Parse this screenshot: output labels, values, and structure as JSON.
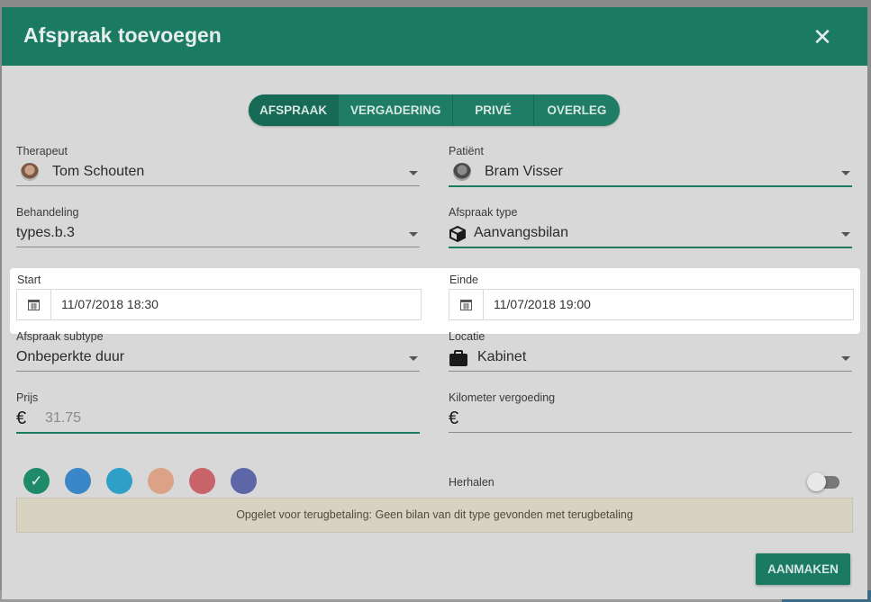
{
  "dialog": {
    "title": "Afspraak toevoegen",
    "close_icon": "close-icon"
  },
  "tabs": [
    {
      "label": "AFSPRAAK",
      "active": true
    },
    {
      "label": "VERGADERING",
      "active": false
    },
    {
      "label": "PRIVÉ",
      "active": false
    },
    {
      "label": "OVERLEG",
      "active": false
    }
  ],
  "fields": {
    "therapeut": {
      "label": "Therapeut",
      "value": "Tom Schouten"
    },
    "patient": {
      "label": "Patiënt",
      "value": "Bram Visser"
    },
    "behandeling": {
      "label": "Behandeling",
      "value": "types.b.3"
    },
    "afspraak_type": {
      "label": "Afspraak type",
      "value": "Aanvangsbilan",
      "icon": "cube-icon"
    },
    "start": {
      "label": "Start",
      "value": "11/07/2018 18:30",
      "icon": "calendar-icon"
    },
    "einde": {
      "label": "Einde",
      "value": "11/07/2018 19:00",
      "icon": "calendar-icon"
    },
    "subtype": {
      "label": "Afspraak subtype",
      "value": "Onbeperkte duur"
    },
    "locatie": {
      "label": "Locatie",
      "value": "Kabinet",
      "icon": "briefcase-icon"
    },
    "prijs": {
      "label": "Prijs",
      "value": "31.75",
      "symbol": "€"
    },
    "kilometer": {
      "label": "Kilometer vergoeding",
      "value": "",
      "symbol": "€"
    }
  },
  "colors": [
    "#1f8a6a",
    "#3a86c8",
    "#2ea0c8",
    "#dba288",
    "#c9636a",
    "#5d67a8"
  ],
  "selected_color": 0,
  "repeat": {
    "label": "Herhalen",
    "on": false
  },
  "notice": "Opgelet voor terugbetaling:  Geen bilan van dit type gevonden met terugbetaling",
  "create_button": "AANMAKEN",
  "background": {
    "cell_a": "21",
    "cell_b": "22"
  }
}
